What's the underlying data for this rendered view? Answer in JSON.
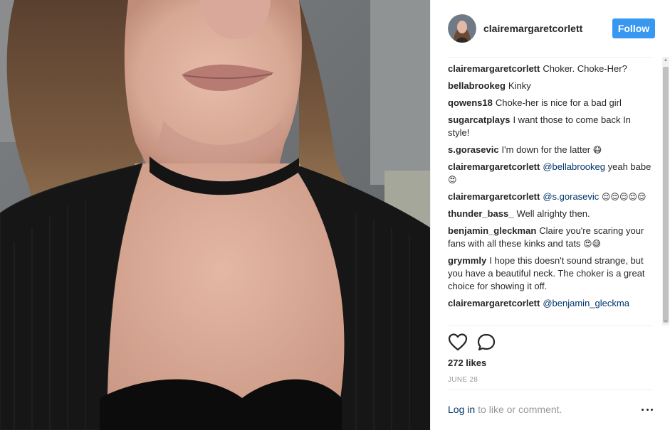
{
  "post": {
    "username": "clairemargaretcorlett",
    "follow_label": "Follow",
    "likes": "272 likes",
    "date": "JUNE 28",
    "login_link": "Log in",
    "login_text": "to like or comment.",
    "more_icon": "more-options-icon",
    "like_icon": "heart-outline-icon",
    "comment_icon": "speech-bubble-icon"
  },
  "comments": [
    {
      "author": "clairemargaretcorlett",
      "parts": [
        {
          "t": "Choker. Choke-Her?"
        }
      ]
    },
    {
      "author": "bellabrookeg",
      "parts": [
        {
          "t": "Kinky"
        }
      ]
    },
    {
      "author": "qowens18",
      "parts": [
        {
          "t": "Choke-her is nice for a bad girl"
        }
      ]
    },
    {
      "author": "sugarcatplays",
      "parts": [
        {
          "t": "I want those to come back In style!"
        }
      ]
    },
    {
      "author": "s.gorasevic",
      "parts": [
        {
          "t": "I'm down for the latter "
        },
        {
          "t": "😷",
          "e": true
        }
      ]
    },
    {
      "author": "clairemargaretcorlett",
      "parts": [
        {
          "t": "@bellabrookeg",
          "m": true
        },
        {
          "t": " yeah babe "
        },
        {
          "t": "😍",
          "e": true
        }
      ]
    },
    {
      "author": "clairemargaretcorlett",
      "parts": [
        {
          "t": "@s.gorasevic",
          "m": true
        },
        {
          "t": " "
        },
        {
          "t": "😌😌😌😌😌",
          "e": true
        }
      ]
    },
    {
      "author": "thunder_bass_",
      "parts": [
        {
          "t": "Well alrighty then."
        }
      ]
    },
    {
      "author": "benjamin_gleckman",
      "parts": [
        {
          "t": "Claire you're scaring your fans with all these kinks and tats "
        },
        {
          "t": "😍😅",
          "e": true
        }
      ]
    },
    {
      "author": "grymmly",
      "parts": [
        {
          "t": "I hope this doesn't sound strange, but you have a beautiful neck. The choker is a great choice for showing it off."
        }
      ]
    },
    {
      "author": "clairemargaretcorlett",
      "parts": [
        {
          "t": "@benjamin_gleckma",
          "m": true
        }
      ]
    }
  ],
  "colors": {
    "follow_bg": "#3897f0",
    "mention": "#003569",
    "muted": "#999999"
  }
}
